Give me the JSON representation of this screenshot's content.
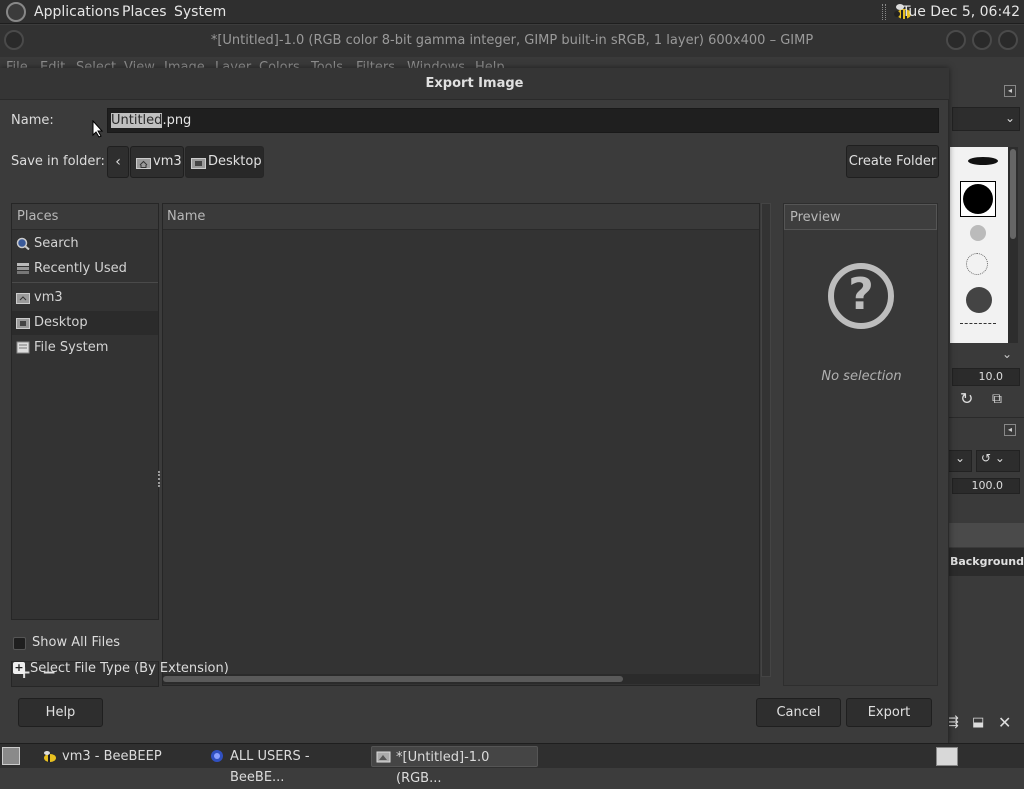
{
  "top_panel": {
    "menus": [
      "Applications",
      "Places",
      "System"
    ],
    "clock": "Tue Dec  5, 06:42"
  },
  "gimp": {
    "title": "*[Untitled]-1.0 (RGB color 8-bit gamma integer, GIMP built-in sRGB, 1 layer) 600x400 – GIMP",
    "menu": [
      "File",
      "Edit",
      "Select",
      "View",
      "Image",
      "Layer",
      "Colors",
      "Tools",
      "Filters",
      "Windows",
      "Help"
    ],
    "dock": {
      "brush_size": "10.0",
      "opacity": "100.0",
      "layer_name": "Background"
    }
  },
  "dialog": {
    "title": "Export Image",
    "name_label": "Name:",
    "filename_selected": "Untitled",
    "filename_ext": ".png",
    "save_in_label": "Save in folder:",
    "path": [
      "vm3",
      "Desktop"
    ],
    "create_folder": "Create Folder",
    "places_header": "Places",
    "places": [
      {
        "label": "Search",
        "icon": "search-icon"
      },
      {
        "label": "Recently Used",
        "icon": "recent-icon"
      },
      {
        "label": "vm3",
        "icon": "home-folder-icon"
      },
      {
        "label": "Desktop",
        "icon": "desktop-folder-icon",
        "active": true
      },
      {
        "label": "File System",
        "icon": "drive-icon"
      }
    ],
    "name_column": "Name",
    "preview_header": "Preview",
    "preview_empty": "No selection",
    "show_all_files": "Show All Files",
    "select_file_type": "Select File Type (By Extension)",
    "buttons": {
      "help": "Help",
      "cancel": "Cancel",
      "export": "Export"
    }
  },
  "taskbar": {
    "tasks": [
      {
        "label": "vm3 - BeeBEEP",
        "active": false
      },
      {
        "label": "ALL USERS - BeeBE...",
        "active": false
      },
      {
        "label": "*[Untitled]-1.0 (RGB...",
        "active": true
      }
    ]
  }
}
